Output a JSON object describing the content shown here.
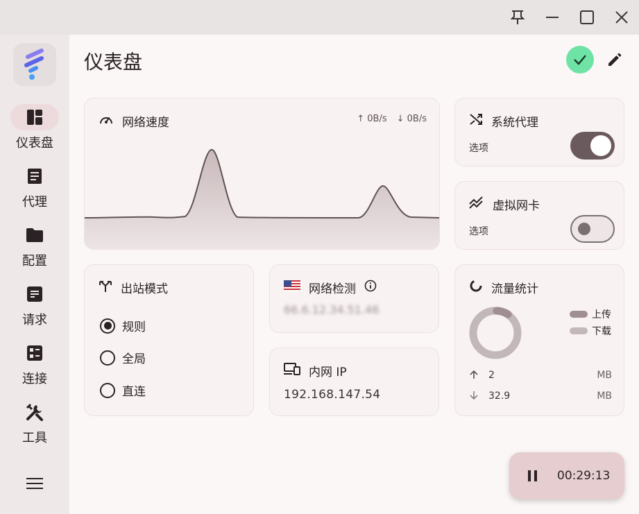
{
  "window": {
    "controls": {
      "pin_icon": "pin-icon",
      "minimize_icon": "minimize-icon",
      "maximize_icon": "maximize-icon",
      "close_icon": "close-icon"
    }
  },
  "sidebar": {
    "items": [
      {
        "label": "仪表盘",
        "icon": "dashboard-icon",
        "active": true
      },
      {
        "label": "代理",
        "icon": "proxy-icon",
        "active": false
      },
      {
        "label": "配置",
        "icon": "folder-icon",
        "active": false
      },
      {
        "label": "请求",
        "icon": "requests-icon",
        "active": false
      },
      {
        "label": "连接",
        "icon": "connections-icon",
        "active": false
      },
      {
        "label": "工具",
        "icon": "tools-icon",
        "active": false
      }
    ]
  },
  "header": {
    "title": "仪表盘"
  },
  "speed": {
    "title": "网络速度",
    "up": "↑ 0B/s",
    "down": "↓ 0B/s"
  },
  "system_proxy": {
    "title": "系统代理",
    "sub": "选项",
    "enabled": true
  },
  "virtual_nic": {
    "title": "虚拟网卡",
    "sub": "选项",
    "enabled": false
  },
  "outbound": {
    "title": "出站模式",
    "options": [
      {
        "label": "规则",
        "checked": true
      },
      {
        "label": "全局",
        "checked": false
      },
      {
        "label": "直连",
        "checked": false
      }
    ]
  },
  "network_check": {
    "title": "网络检测",
    "result": "66.6.12.34.51.46"
  },
  "intranet": {
    "title": "内网 IP",
    "value": "192.168.147.54"
  },
  "traffic": {
    "title": "流量统计",
    "legend_upload": "上传",
    "legend_download": "下载",
    "upload_value": "2",
    "upload_unit": "MB",
    "download_value": "32.9",
    "download_unit": "MB",
    "colors": {
      "upload": "#a08f92",
      "download": "#c2b8b9"
    }
  },
  "timer": {
    "value": "00:29:13"
  },
  "colors": {
    "accent": "#6b5a5d",
    "status_ok": "#6fe3a5"
  }
}
